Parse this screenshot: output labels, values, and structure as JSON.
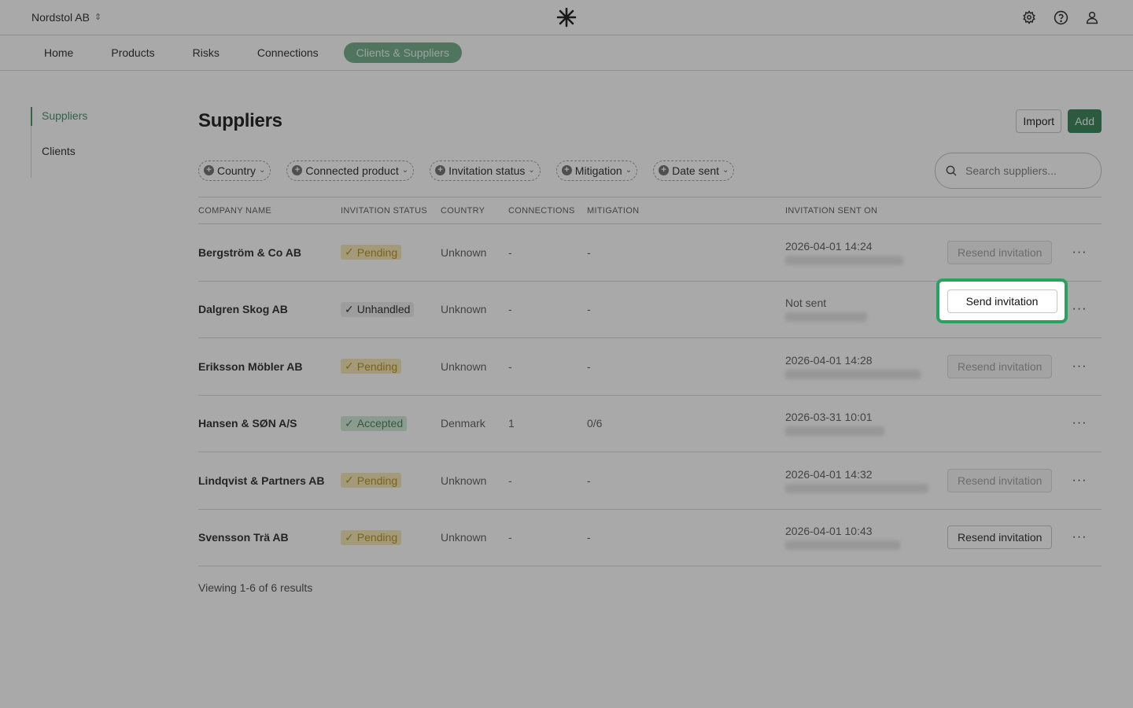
{
  "topbar": {
    "org_name": "Nordstol AB",
    "icons": [
      "settings-icon",
      "help-icon",
      "user-icon"
    ]
  },
  "nav": {
    "items": [
      "Home",
      "Products",
      "Risks",
      "Connections",
      "Clients & Suppliers"
    ],
    "active": "Clients & Suppliers"
  },
  "sidenav": {
    "items": [
      "Suppliers",
      "Clients"
    ],
    "active": "Suppliers"
  },
  "page": {
    "title": "Suppliers",
    "import_label": "Import",
    "add_label": "Add"
  },
  "filters": [
    "Country",
    "Connected product",
    "Invitation status",
    "Mitigation",
    "Date sent"
  ],
  "search": {
    "placeholder": "Search suppliers..."
  },
  "table": {
    "headers": [
      "COMPANY NAME",
      "INVITATION STATUS",
      "COUNTRY",
      "CONNECTIONS",
      "MITIGATION",
      "INVITATION SENT ON"
    ],
    "rows": [
      {
        "company": "Bergström & Co AB",
        "status": "Pending",
        "country": "Unknown",
        "connections": "-",
        "mitigation": "-",
        "sent": "2026-04-01 14:24",
        "action": "Resend invitation"
      },
      {
        "company": "Dalgren Skog AB",
        "status": "Unhandled",
        "country": "Unknown",
        "connections": "-",
        "mitigation": "-",
        "sent": "Not sent",
        "action": "Send invitation"
      },
      {
        "company": "Eriksson Möbler AB",
        "status": "Pending",
        "country": "Unknown",
        "connections": "-",
        "mitigation": "-",
        "sent": "2026-04-01 14:28",
        "action": "Resend invitation"
      },
      {
        "company": "Hansen & SØN A/S",
        "status": "Accepted",
        "country": "Denmark",
        "connections": "1",
        "mitigation": "0/6",
        "sent": "2026-03-31 10:01",
        "action": ""
      },
      {
        "company": "Lindqvist & Partners AB",
        "status": "Pending",
        "country": "Unknown",
        "connections": "-",
        "mitigation": "-",
        "sent": "2026-04-01 14:32",
        "action": "Resend invitation"
      },
      {
        "company": "Svensson Trä AB",
        "status": "Pending",
        "country": "Unknown",
        "connections": "-",
        "mitigation": "-",
        "sent": "2026-04-01 10:43",
        "action": "Resend invitation"
      }
    ]
  },
  "footer": {
    "results_text": "Viewing 1-6 of 6 results"
  },
  "colors": {
    "accent": "#2e7d4f",
    "highlight": "#27a35f",
    "pending_bg": "#f3e6b0",
    "accepted_bg": "#cfe8d6"
  }
}
